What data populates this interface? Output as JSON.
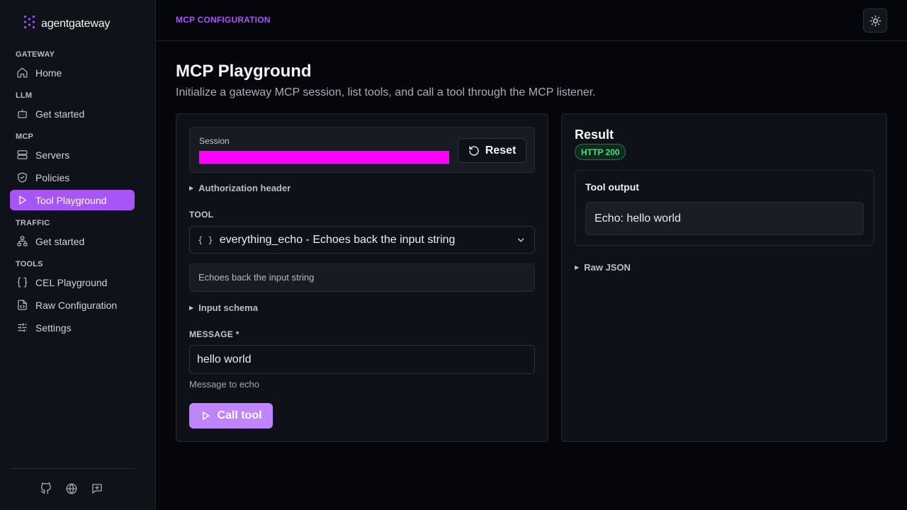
{
  "app": {
    "name": "agentgateway",
    "accent_color": "#a855f7"
  },
  "sidebar": {
    "groups": [
      {
        "title": "GATEWAY",
        "items": [
          {
            "label": "Home",
            "icon": "home-icon"
          }
        ]
      },
      {
        "title": "LLM",
        "items": [
          {
            "label": "Get started",
            "icon": "bot-icon"
          }
        ]
      },
      {
        "title": "MCP",
        "items": [
          {
            "label": "Servers",
            "icon": "server-icon"
          },
          {
            "label": "Policies",
            "icon": "shield-icon"
          },
          {
            "label": "Tool Playground",
            "icon": "play-icon",
            "active": true
          }
        ]
      },
      {
        "title": "TRAFFIC",
        "items": [
          {
            "label": "Get started",
            "icon": "network-icon"
          }
        ]
      },
      {
        "title": "TOOLS",
        "items": [
          {
            "label": "CEL Playground",
            "icon": "braces-icon"
          },
          {
            "label": "Raw Configuration",
            "icon": "file-code-icon"
          },
          {
            "label": "Settings",
            "icon": "sliders-icon"
          }
        ]
      }
    ],
    "footer_icons": [
      "github-icon",
      "globe-icon",
      "feedback-icon"
    ]
  },
  "header": {
    "breadcrumb": "MCP CONFIGURATION",
    "theme_toggle_icon": "sun-icon"
  },
  "main": {
    "title": "MCP Playground",
    "subtitle": "Initialize a gateway MCP session, list tools, and call a tool through the MCP listener.",
    "session": {
      "label": "Session",
      "reset_label": "Reset"
    },
    "authorization": {
      "label": "Authorization header"
    },
    "tool": {
      "label": "TOOL",
      "selected": "everything_echo - Echoes back the input string",
      "description": "Echoes back the input string"
    },
    "input_schema": {
      "label": "Input schema"
    },
    "message": {
      "label": "MESSAGE *",
      "value": "hello world",
      "hint": "Message to echo"
    },
    "call_label": "Call tool"
  },
  "result": {
    "title": "Result",
    "status": "HTTP 200",
    "status_color": "#4ade80",
    "output_title": "Tool output",
    "output_value": "Echo: hello world",
    "raw_json_label": "Raw JSON"
  }
}
